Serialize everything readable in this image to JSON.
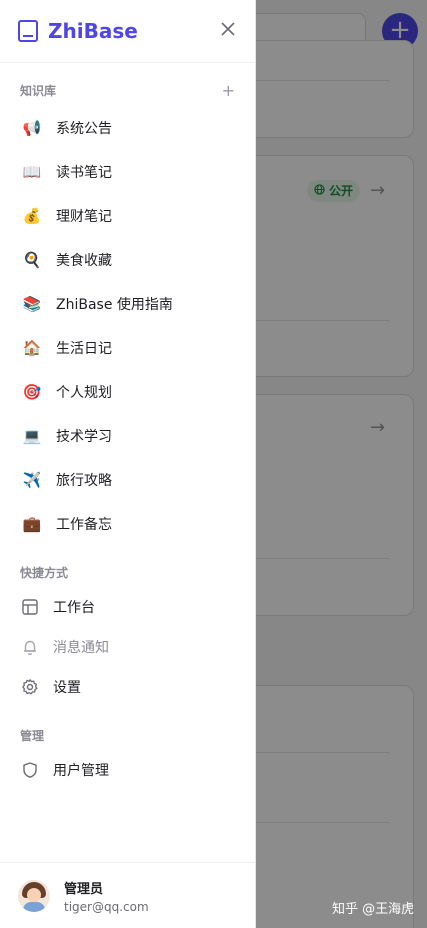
{
  "app": {
    "logo_text": "ZhiBase"
  },
  "background": {
    "badge_public": "公开",
    "fab_symbol": "+"
  },
  "drawer": {
    "kb_section_title": "知识库",
    "kb_add_symbol": "+",
    "knowledge_bases": [
      {
        "emoji": "📢",
        "label": "系统公告"
      },
      {
        "emoji": "📖",
        "label": "读书笔记"
      },
      {
        "emoji": "💰",
        "label": "理财笔记"
      },
      {
        "emoji": "🍳",
        "label": "美食收藏"
      },
      {
        "emoji": "📚",
        "label": "ZhiBase 使用指南"
      },
      {
        "emoji": "🏠",
        "label": "生活日记"
      },
      {
        "emoji": "🎯",
        "label": "个人规划"
      },
      {
        "emoji": "💻",
        "label": "技术学习"
      },
      {
        "emoji": "✈️",
        "label": "旅行攻略"
      },
      {
        "emoji": "💼",
        "label": "工作备忘"
      }
    ],
    "shortcut_section_title": "快捷方式",
    "shortcuts": [
      {
        "icon": "layout-icon",
        "label": "工作台"
      },
      {
        "icon": "bell-icon",
        "label": "消息通知"
      },
      {
        "icon": "gear-icon",
        "label": "设置"
      }
    ],
    "manage_section_title": "管理",
    "manage_items": [
      {
        "icon": "shield-icon",
        "label": "用户管理"
      }
    ],
    "user": {
      "name": "管理员",
      "email": "tiger@qq.com"
    }
  },
  "watermark": "知乎 @王海虎",
  "colors": {
    "accent": "#4f46e5",
    "text": "#1f1f24",
    "muted": "#8a8a93",
    "badge_green": "#1f8a46"
  }
}
